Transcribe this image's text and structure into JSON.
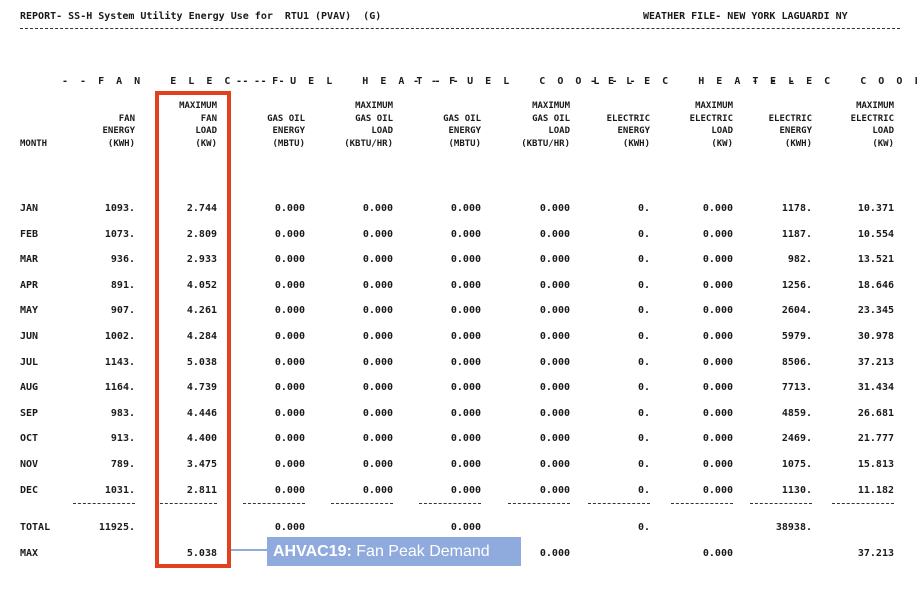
{
  "report": {
    "title": "REPORT- SS-H System Utility Energy Use for  RTU1 (PVAV)  (G)",
    "weather": "WEATHER FILE- NEW YORK LAGUARDI NY"
  },
  "group_headers": {
    "fan_elec": "- - F A N   E L E C - - -",
    "fuel_heat": "- - F U E L   H E A T - -",
    "fuel_cool": "- - F U E L   C O O L - -",
    "elec_heat": "- E L E C   H E A T - -",
    "elec_cool": "- E L E C   C O O L - -"
  },
  "columns": [
    {
      "key": "month",
      "header": "\n\n\nMONTH"
    },
    {
      "key": "fan_energy",
      "header": "\nFAN\nENERGY\n(KWH)"
    },
    {
      "key": "max_fan_load",
      "header": "MAXIMUM\nFAN\nLOAD\n(KW)"
    },
    {
      "key": "gas_oil_energy_h",
      "header": "\nGAS OIL\nENERGY\n(MBTU)"
    },
    {
      "key": "max_gas_oil_load_h",
      "header": "MAXIMUM\nGAS OIL\nLOAD\n(KBTU/HR)"
    },
    {
      "key": "gas_oil_energy_c",
      "header": "\nGAS OIL\nENERGY\n(MBTU)"
    },
    {
      "key": "max_gas_oil_load_c",
      "header": "MAXIMUM\nGAS OIL\nLOAD\n(KBTU/HR)"
    },
    {
      "key": "elec_energy_h",
      "header": "\nELECTRIC\nENERGY\n(KWH)"
    },
    {
      "key": "max_elec_load_h",
      "header": "MAXIMUM\nELECTRIC\nLOAD\n(KW)"
    },
    {
      "key": "elec_energy_c",
      "header": "\nELECTRIC\nENERGY\n(KWH)"
    },
    {
      "key": "max_elec_load_c",
      "header": "MAXIMUM\nELECTRIC\nLOAD\n(KW)"
    }
  ],
  "rows": [
    [
      "JAN",
      "1093.",
      "2.744",
      "0.000",
      "0.000",
      "0.000",
      "0.000",
      "0.",
      "0.000",
      "1178.",
      "10.371"
    ],
    [
      "FEB",
      "1073.",
      "2.809",
      "0.000",
      "0.000",
      "0.000",
      "0.000",
      "0.",
      "0.000",
      "1187.",
      "10.554"
    ],
    [
      "MAR",
      "936.",
      "2.933",
      "0.000",
      "0.000",
      "0.000",
      "0.000",
      "0.",
      "0.000",
      "982.",
      "13.521"
    ],
    [
      "APR",
      "891.",
      "4.052",
      "0.000",
      "0.000",
      "0.000",
      "0.000",
      "0.",
      "0.000",
      "1256.",
      "18.646"
    ],
    [
      "MAY",
      "907.",
      "4.261",
      "0.000",
      "0.000",
      "0.000",
      "0.000",
      "0.",
      "0.000",
      "2604.",
      "23.345"
    ],
    [
      "JUN",
      "1002.",
      "4.284",
      "0.000",
      "0.000",
      "0.000",
      "0.000",
      "0.",
      "0.000",
      "5979.",
      "30.978"
    ],
    [
      "JUL",
      "1143.",
      "5.038",
      "0.000",
      "0.000",
      "0.000",
      "0.000",
      "0.",
      "0.000",
      "8506.",
      "37.213"
    ],
    [
      "AUG",
      "1164.",
      "4.739",
      "0.000",
      "0.000",
      "0.000",
      "0.000",
      "0.",
      "0.000",
      "7713.",
      "31.434"
    ],
    [
      "SEP",
      "983.",
      "4.446",
      "0.000",
      "0.000",
      "0.000",
      "0.000",
      "0.",
      "0.000",
      "4859.",
      "26.681"
    ],
    [
      "OCT",
      "913.",
      "4.400",
      "0.000",
      "0.000",
      "0.000",
      "0.000",
      "0.",
      "0.000",
      "2469.",
      "21.777"
    ],
    [
      "NOV",
      "789.",
      "3.475",
      "0.000",
      "0.000",
      "0.000",
      "0.000",
      "0.",
      "0.000",
      "1075.",
      "15.813"
    ],
    [
      "DEC",
      "1031.",
      "2.811",
      "0.000",
      "0.000",
      "0.000",
      "0.000",
      "0.",
      "0.000",
      "1130.",
      "11.182"
    ]
  ],
  "total_row": [
    "TOTAL",
    "11925.",
    "",
    "0.000",
    "",
    "0.000",
    "",
    "0.",
    "",
    "38938.",
    ""
  ],
  "max_row": [
    "MAX",
    "",
    "5.038",
    "",
    "",
    "",
    "0.000",
    "",
    "0.000",
    "",
    "37.213"
  ],
  "callout": {
    "code": "AHVAC19:",
    "text": " Fan Peak Demand",
    "color": "#8faadc"
  },
  "highlight_color": "#e0421f"
}
